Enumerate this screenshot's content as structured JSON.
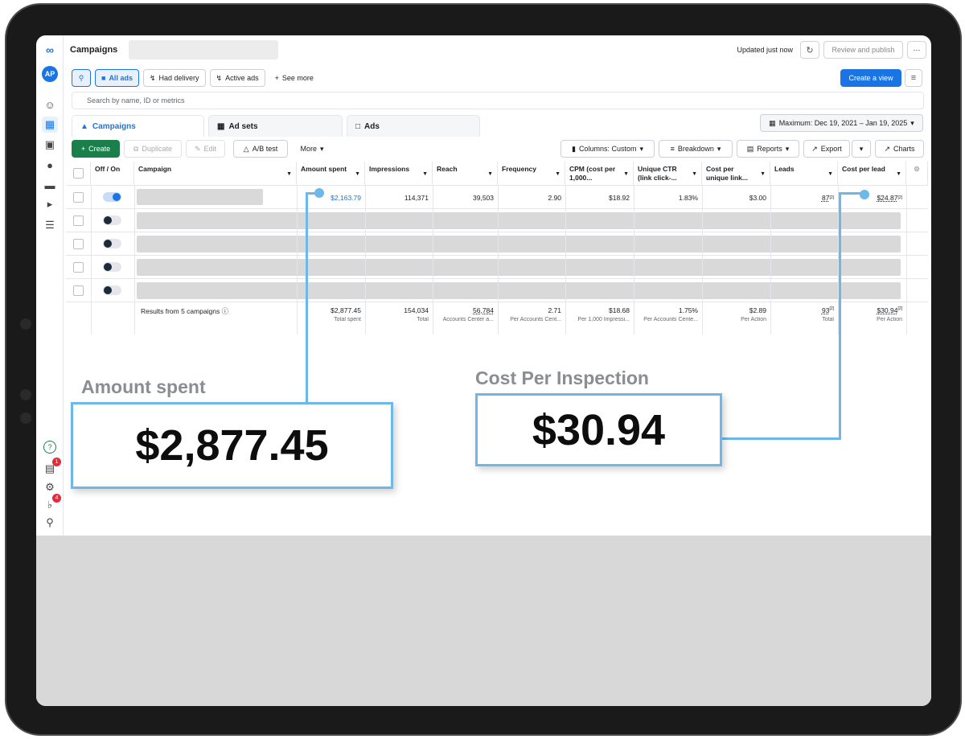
{
  "header": {
    "title": "Campaigns",
    "updated": "Updated just now",
    "review_publish": "Review and publish",
    "more": "···"
  },
  "sidebar": {
    "logo_text": "AP",
    "badge_one": "1",
    "badge_two": "4"
  },
  "filters": {
    "all_ads": "All ads",
    "had_delivery": "Had delivery",
    "active_ads": "Active ads",
    "see_more": "See more",
    "create_view": "Create a view"
  },
  "search": {
    "placeholder": "Search by name, ID or metrics"
  },
  "tabs": {
    "campaigns": "Campaigns",
    "ad_sets": "Ad sets",
    "ads": "Ads",
    "date_range": "Maximum: Dec 19, 2021 – Jan 19, 2025"
  },
  "toolbar": {
    "create": "Create",
    "duplicate": "Duplicate",
    "edit": "Edit",
    "ab_test": "A/B test",
    "more": "More",
    "columns": "Columns: Custom",
    "breakdown": "Breakdown",
    "reports": "Reports",
    "export": "Export",
    "charts": "Charts"
  },
  "columns": {
    "off_on": "Off / On",
    "campaign": "Campaign",
    "amount_spent": "Amount spent",
    "impressions": "Impressions",
    "reach": "Reach",
    "frequency": "Frequency",
    "cpm": "CPM (cost per 1,000...",
    "unique_ctr": "Unique CTR (link click-...",
    "cost_per_unique": "Cost per unique link...",
    "leads": "Leads",
    "cost_per_lead": "Cost per lead"
  },
  "first_row": {
    "amount_spent": "$2,163.79",
    "impressions": "114,371",
    "reach": "39,503",
    "frequency": "2.90",
    "cpm": "$18.92",
    "unique_ctr": "1.83%",
    "cost_per_unique": "$3.00",
    "leads": "87",
    "leads_note": "[2]",
    "cost_per_lead": "$24.87",
    "cpl_note": "[2]"
  },
  "summary": {
    "label": "Results from 5 campaigns",
    "amount_spent": "$2,877.45",
    "amount_spent_sub": "Total spent",
    "impressions": "154,034",
    "impressions_sub": "Total",
    "reach": "56,784",
    "reach_sub": "Accounts Center a...",
    "frequency": "2.71",
    "frequency_sub": "Per Accounts Cent...",
    "cpm": "$18.68",
    "cpm_sub": "Per 1,000 Impressi...",
    "unique_ctr": "1.75%",
    "unique_ctr_sub": "Per Accounts Cente...",
    "cost_per_unique": "$2.89",
    "cost_per_unique_sub": "Per Action",
    "leads": "93",
    "leads_note": "[2]",
    "leads_sub": "Total",
    "cost_per_lead": "$30.94",
    "cpl_note": "[2]",
    "cost_per_lead_sub": "Per Action"
  },
  "callouts": {
    "amount_label": "Amount spent",
    "amount_value": "$2,877.45",
    "cost_label": "Cost Per Inspection",
    "cost_value": "$30.94"
  },
  "colors": {
    "accent": "#1b74e4",
    "callout": "#6db8e8",
    "create_green": "#1a7f4b"
  }
}
